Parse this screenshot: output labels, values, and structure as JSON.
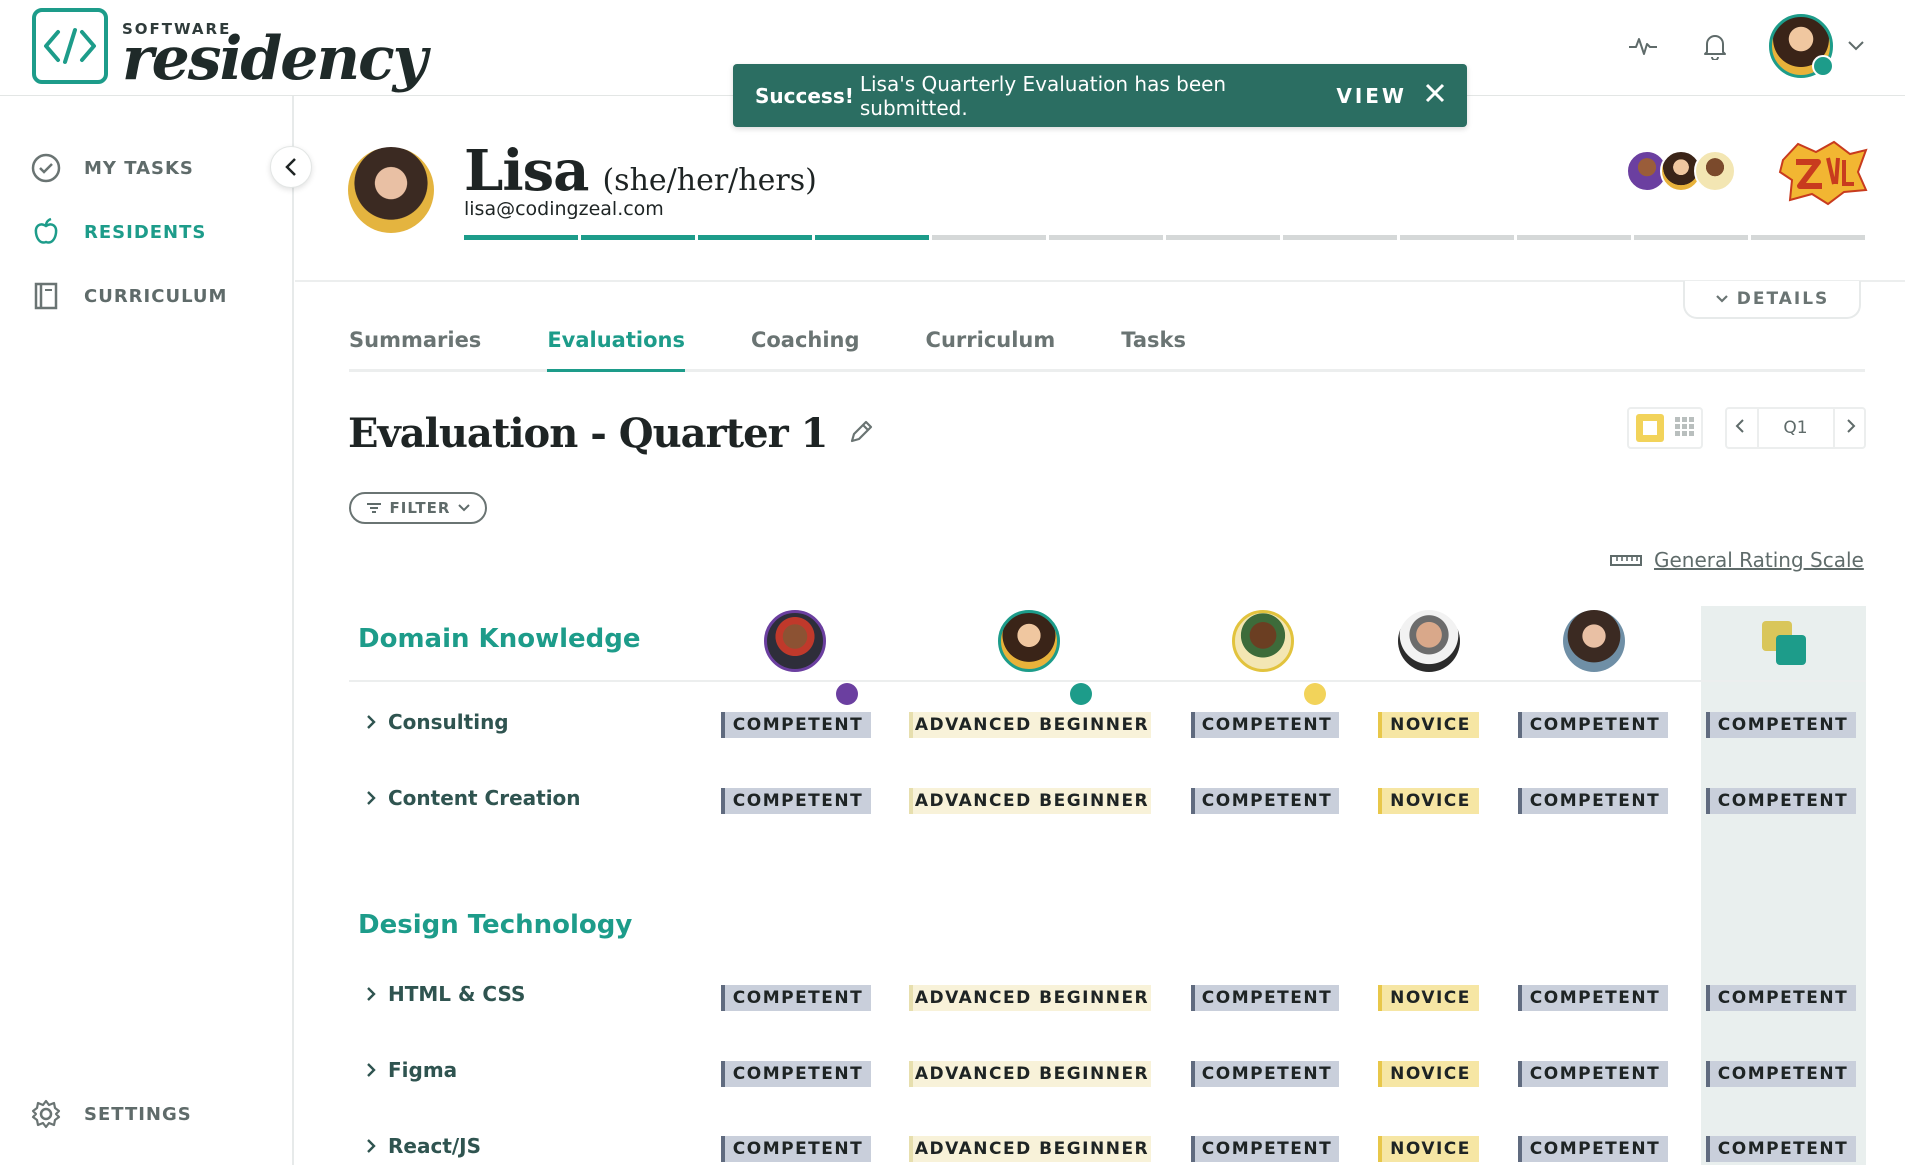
{
  "brand": {
    "small": "SOFTWARE",
    "script": "residency"
  },
  "toast": {
    "strong": "Success!",
    "message": "Lisa's Quarterly Evaluation has been submitted.",
    "action": "VIEW"
  },
  "sidebar": {
    "items": [
      {
        "label": "MY TASKS"
      },
      {
        "label": "RESIDENTS"
      },
      {
        "label": "CURRICULUM"
      }
    ],
    "settings": "SETTINGS"
  },
  "profile": {
    "name": "Lisa",
    "pronouns": "(she/her/hers)",
    "email": "lisa@codingzeal.com",
    "progress_completed": 4,
    "progress_total": 12
  },
  "details_label": "DETAILS",
  "tabs": [
    "Summaries",
    "Evaluations",
    "Coaching",
    "Curriculum",
    "Tasks"
  ],
  "active_tab": "Evaluations",
  "evaluation": {
    "title": "Evaluation - Quarter 1",
    "filter": "FILTER",
    "quarter": "Q1",
    "rating_scale": "General Rating Scale"
  },
  "sections": [
    {
      "title": "Domain Knowledge",
      "rows": [
        {
          "label": "Consulting",
          "ratings": [
            "COMPETENT",
            "ADVANCED BEGINNER",
            "COMPETENT",
            "NOVICE",
            "COMPETENT",
            "COMPETENT"
          ]
        },
        {
          "label": "Content Creation",
          "ratings": [
            "COMPETENT",
            "ADVANCED BEGINNER",
            "COMPETENT",
            "NOVICE",
            "COMPETENT",
            "COMPETENT"
          ]
        }
      ]
    },
    {
      "title": "Design Technology",
      "rows": [
        {
          "label": "HTML & CSS",
          "ratings": [
            "COMPETENT",
            "ADVANCED BEGINNER",
            "COMPETENT",
            "NOVICE",
            "COMPETENT",
            "COMPETENT"
          ]
        },
        {
          "label": "Figma",
          "ratings": [
            "COMPETENT",
            "ADVANCED BEGINNER",
            "COMPETENT",
            "NOVICE",
            "COMPETENT",
            "COMPETENT"
          ]
        },
        {
          "label": "React/JS",
          "ratings": [
            "COMPETENT",
            "ADVANCED BEGINNER",
            "COMPETENT",
            "NOVICE",
            "COMPETENT",
            "COMPETENT"
          ]
        }
      ]
    }
  ],
  "colors": {
    "accent": "#1d9c8a",
    "toast_bg": "#2b6e62",
    "competent": "#c9cfdb",
    "novice": "#f6e6a4",
    "advanced": "#f8f2d9"
  }
}
